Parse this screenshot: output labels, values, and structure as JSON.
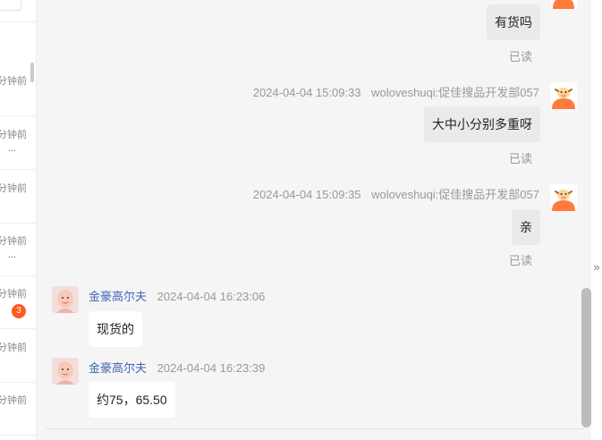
{
  "sidebar": {
    "conversations": [
      {
        "time": "分钟前",
        "preview": "",
        "badge": ""
      },
      {
        "time": "分钟前",
        "preview": "...",
        "badge": ""
      },
      {
        "time": "分钟前",
        "preview": "",
        "badge": ""
      },
      {
        "time": "分钟前",
        "preview": "...",
        "badge": ""
      },
      {
        "time": "分钟前",
        "preview": "",
        "badge": "3"
      },
      {
        "time": "分钟前",
        "preview": "",
        "badge": ""
      },
      {
        "time": "分钟前",
        "preview": "",
        "badge": ""
      }
    ]
  },
  "messages": [
    {
      "dir": "out",
      "text": "有货吗",
      "status": "已读"
    },
    {
      "dir": "out",
      "timestamp": "2024-04-04 15:09:33",
      "sender": "woloveshuqi:促佳搜品开发部057",
      "text": "大中小分别多重呀",
      "status": "已读"
    },
    {
      "dir": "out",
      "timestamp": "2024-04-04 15:09:35",
      "sender": "woloveshuqi:促佳搜品开发部057",
      "text": "亲",
      "status": "已读"
    },
    {
      "dir": "in",
      "sender": "金豪高尔夫",
      "timestamp": "2024-04-04 16:23:06",
      "text": "现货的"
    },
    {
      "dir": "in",
      "sender": "金豪高尔夫",
      "timestamp": "2024-04-04 16:23:39",
      "text": "约75，65.50"
    }
  ],
  "collapse_icon": "double-chevron-right-icon",
  "colors": {
    "accent_badge": "#ff5a1f",
    "sender_link": "#3e63b7",
    "avatar_orange": "#ff7a3d"
  }
}
